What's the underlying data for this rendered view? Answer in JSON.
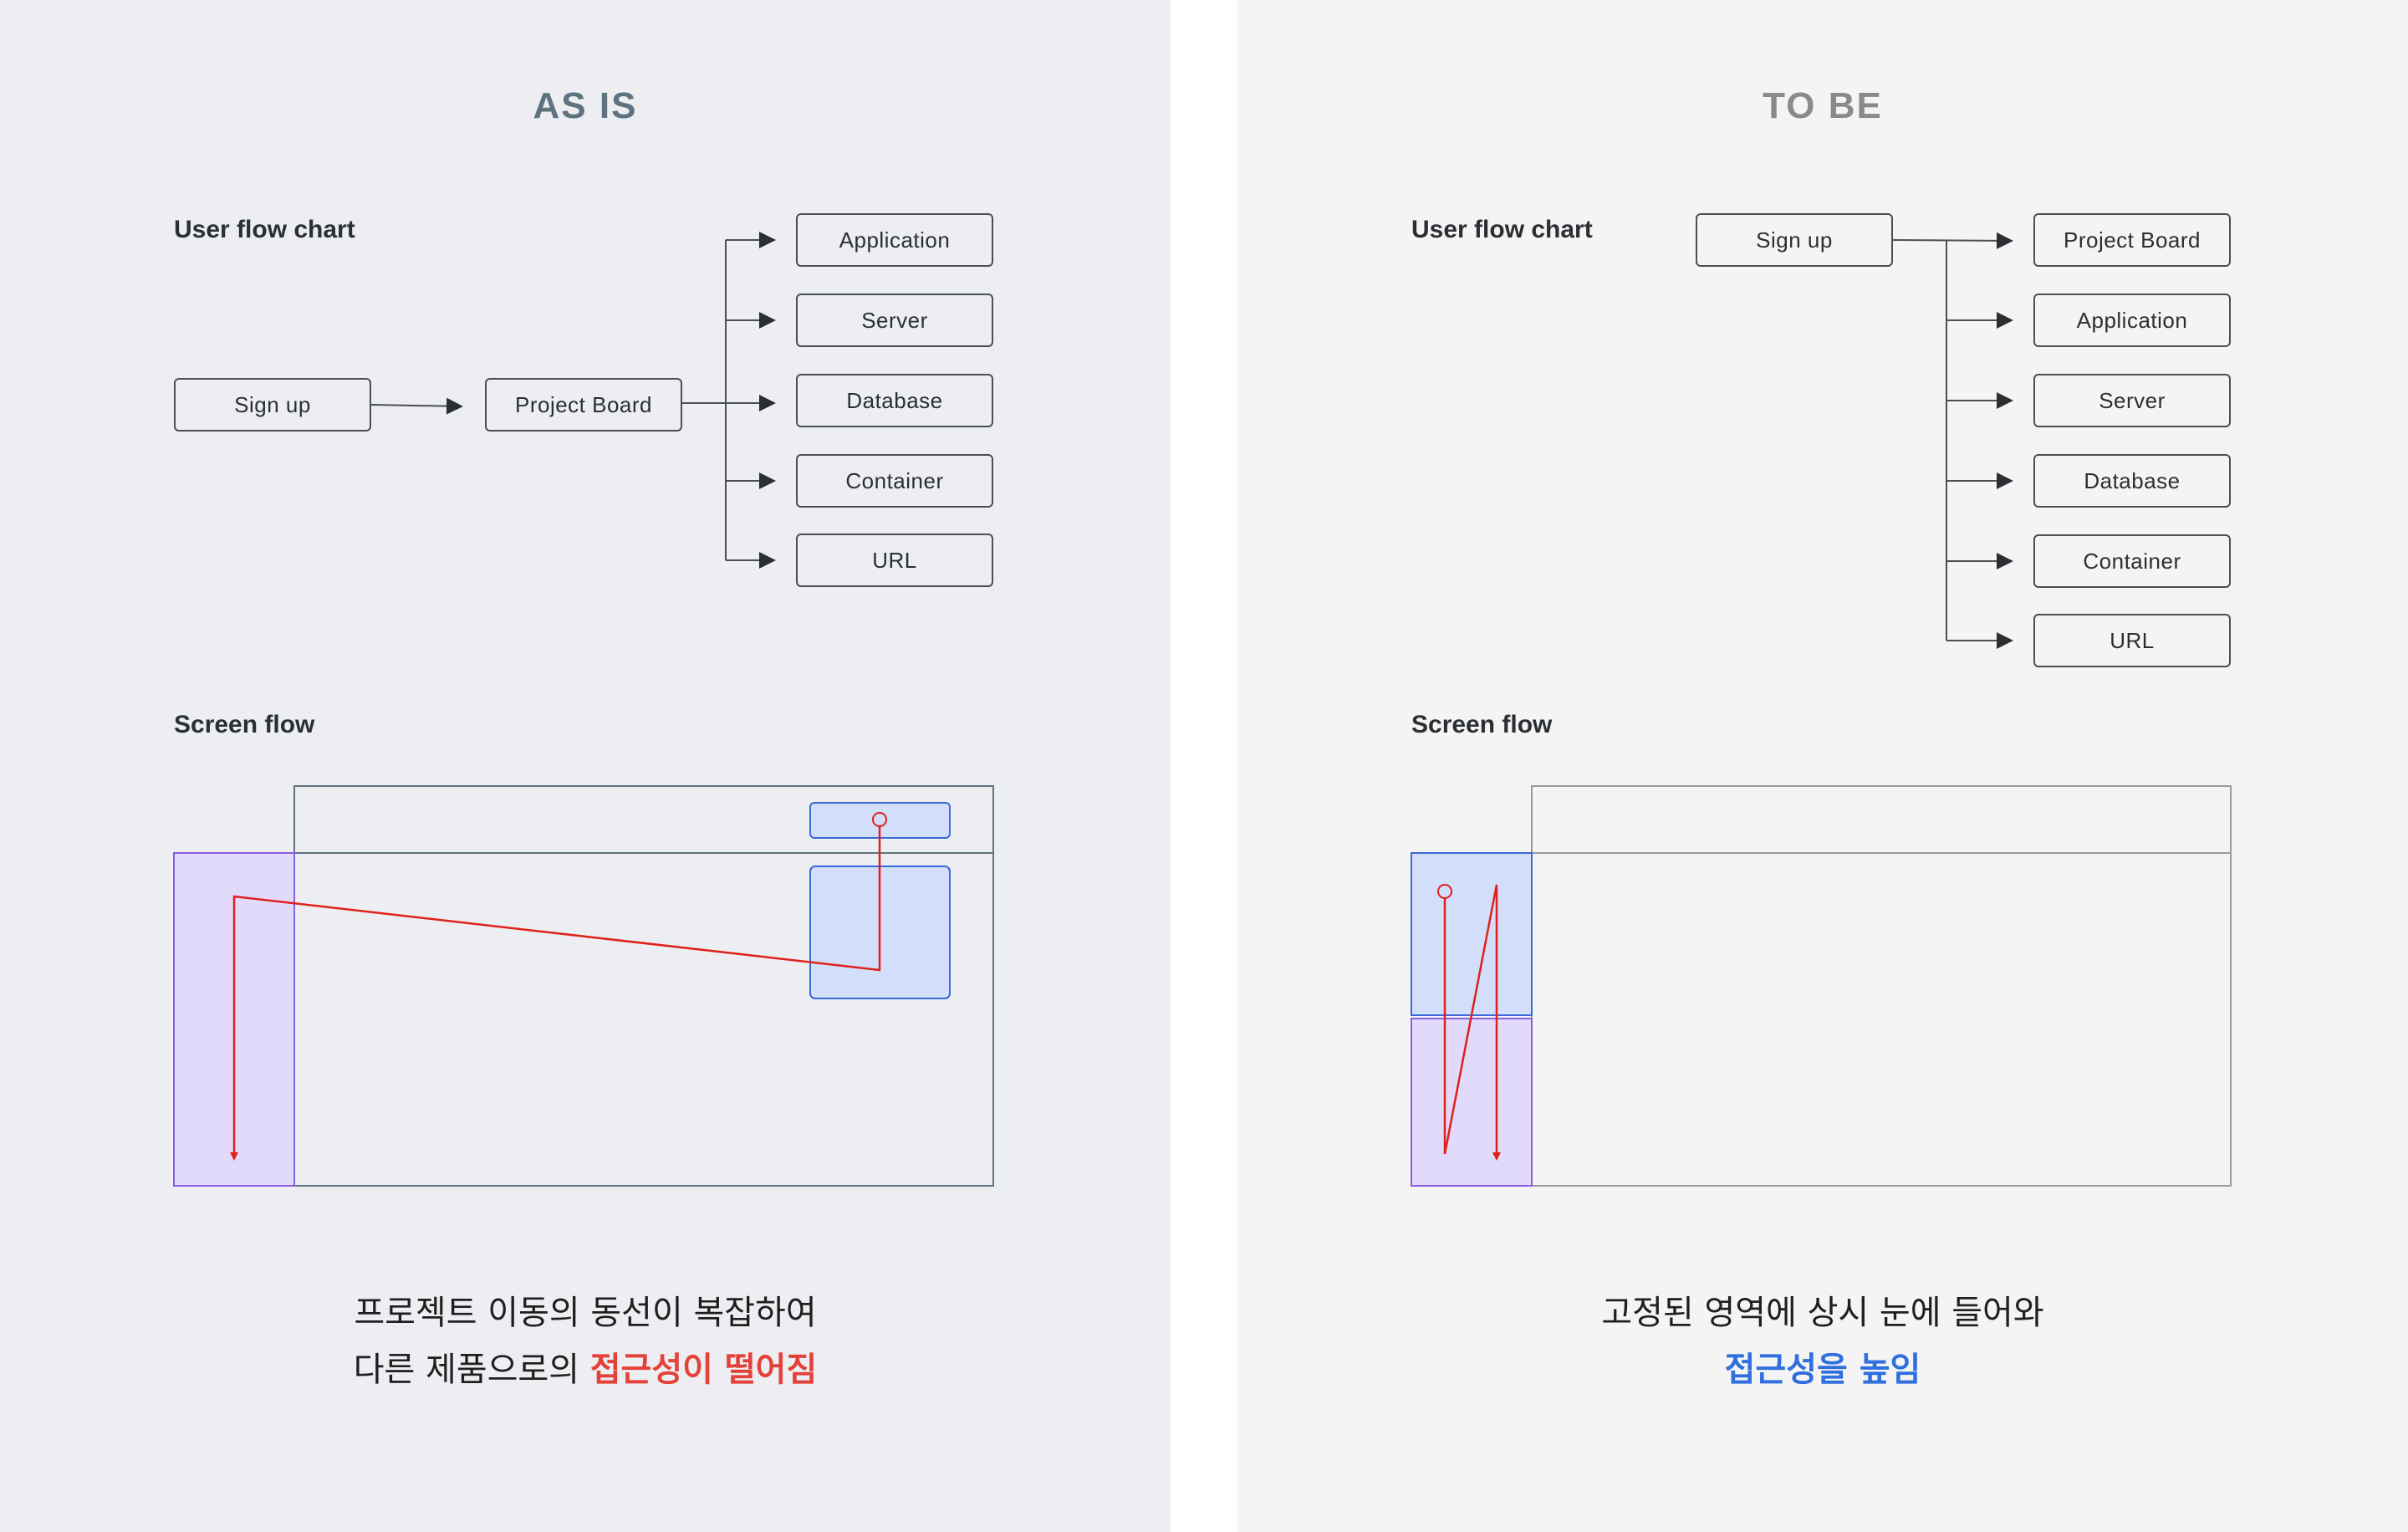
{
  "as_is": {
    "title": "AS IS",
    "user_flow_label": "User flow chart",
    "screen_flow_label": "Screen flow",
    "nodes": {
      "signup": "Sign up",
      "project_board": "Project Board",
      "application": "Application",
      "server": "Server",
      "database": "Database",
      "container": "Container",
      "url": "URL"
    },
    "caption": {
      "line1": "프로젝트 이동의 동선이 복잡하여",
      "line2_prefix": "다른 제품으로의 ",
      "line2_highlight": "접근성이 떨어짐"
    }
  },
  "to_be": {
    "title": "TO BE",
    "user_flow_label": "User flow chart",
    "screen_flow_label": "Screen flow",
    "nodes": {
      "signup": "Sign up",
      "project_board": "Project Board",
      "application": "Application",
      "server": "Server",
      "database": "Database",
      "container": "Container",
      "url": "URL"
    },
    "caption": {
      "line1": "고정된 영역에 상시 눈에 들어와",
      "line2_highlight": "접근성을 높임"
    }
  },
  "colors": {
    "as_is_background": "#eceef1",
    "to_be_background": "#f4f4f4",
    "flow_line": "#e0201b",
    "highlight_blue_fill": "#d2defa",
    "highlight_blue_stroke": "#3a6ad8",
    "highlight_purple_fill": "#e2dafa",
    "highlight_purple_stroke": "#8a5ee0",
    "caption_red": "#e5413b",
    "caption_blue": "#2f6fde"
  }
}
